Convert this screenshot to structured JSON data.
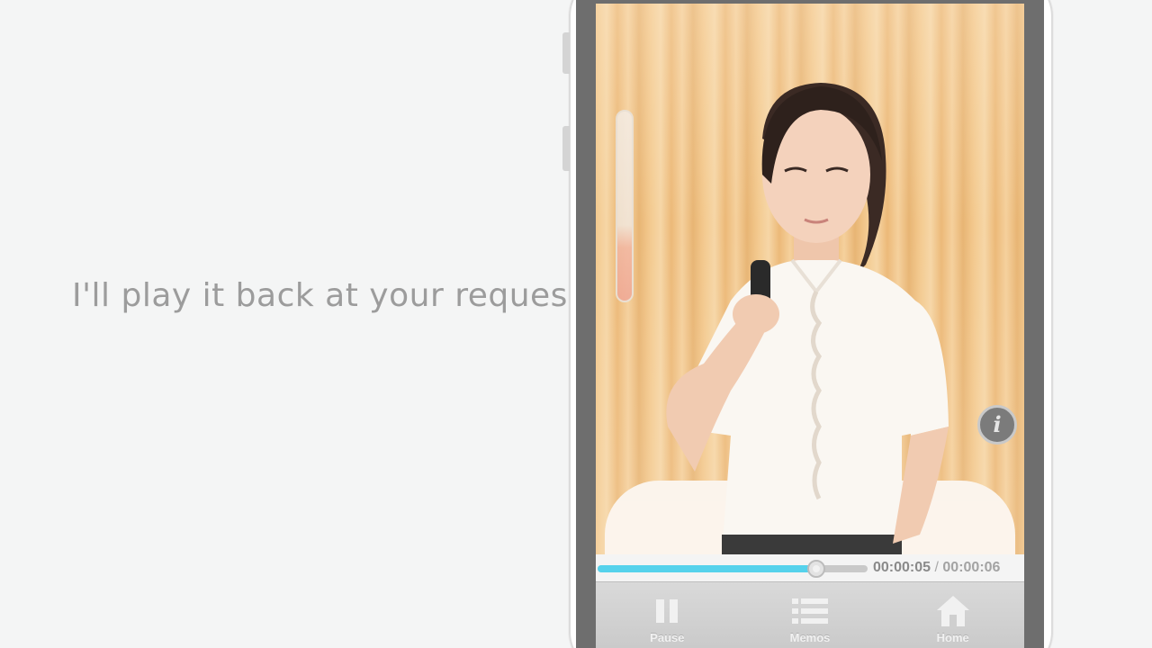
{
  "caption": "I'll play it back at your request",
  "player": {
    "elapsed": "00:00:05",
    "separator": " / ",
    "total": "00:00:06",
    "progress_percent": 81,
    "info_label": "i",
    "volume_level_fraction": 0.35
  },
  "tabs": [
    {
      "label": "Pause",
      "icon": "pause-icon"
    },
    {
      "label": "Memos",
      "icon": "list-icon"
    },
    {
      "label": "Home",
      "icon": "home-icon"
    }
  ],
  "colors": {
    "progress_fill": "#55d2ec",
    "caption_text": "#9c9c9c",
    "tab_label": "#f1f1f1"
  }
}
